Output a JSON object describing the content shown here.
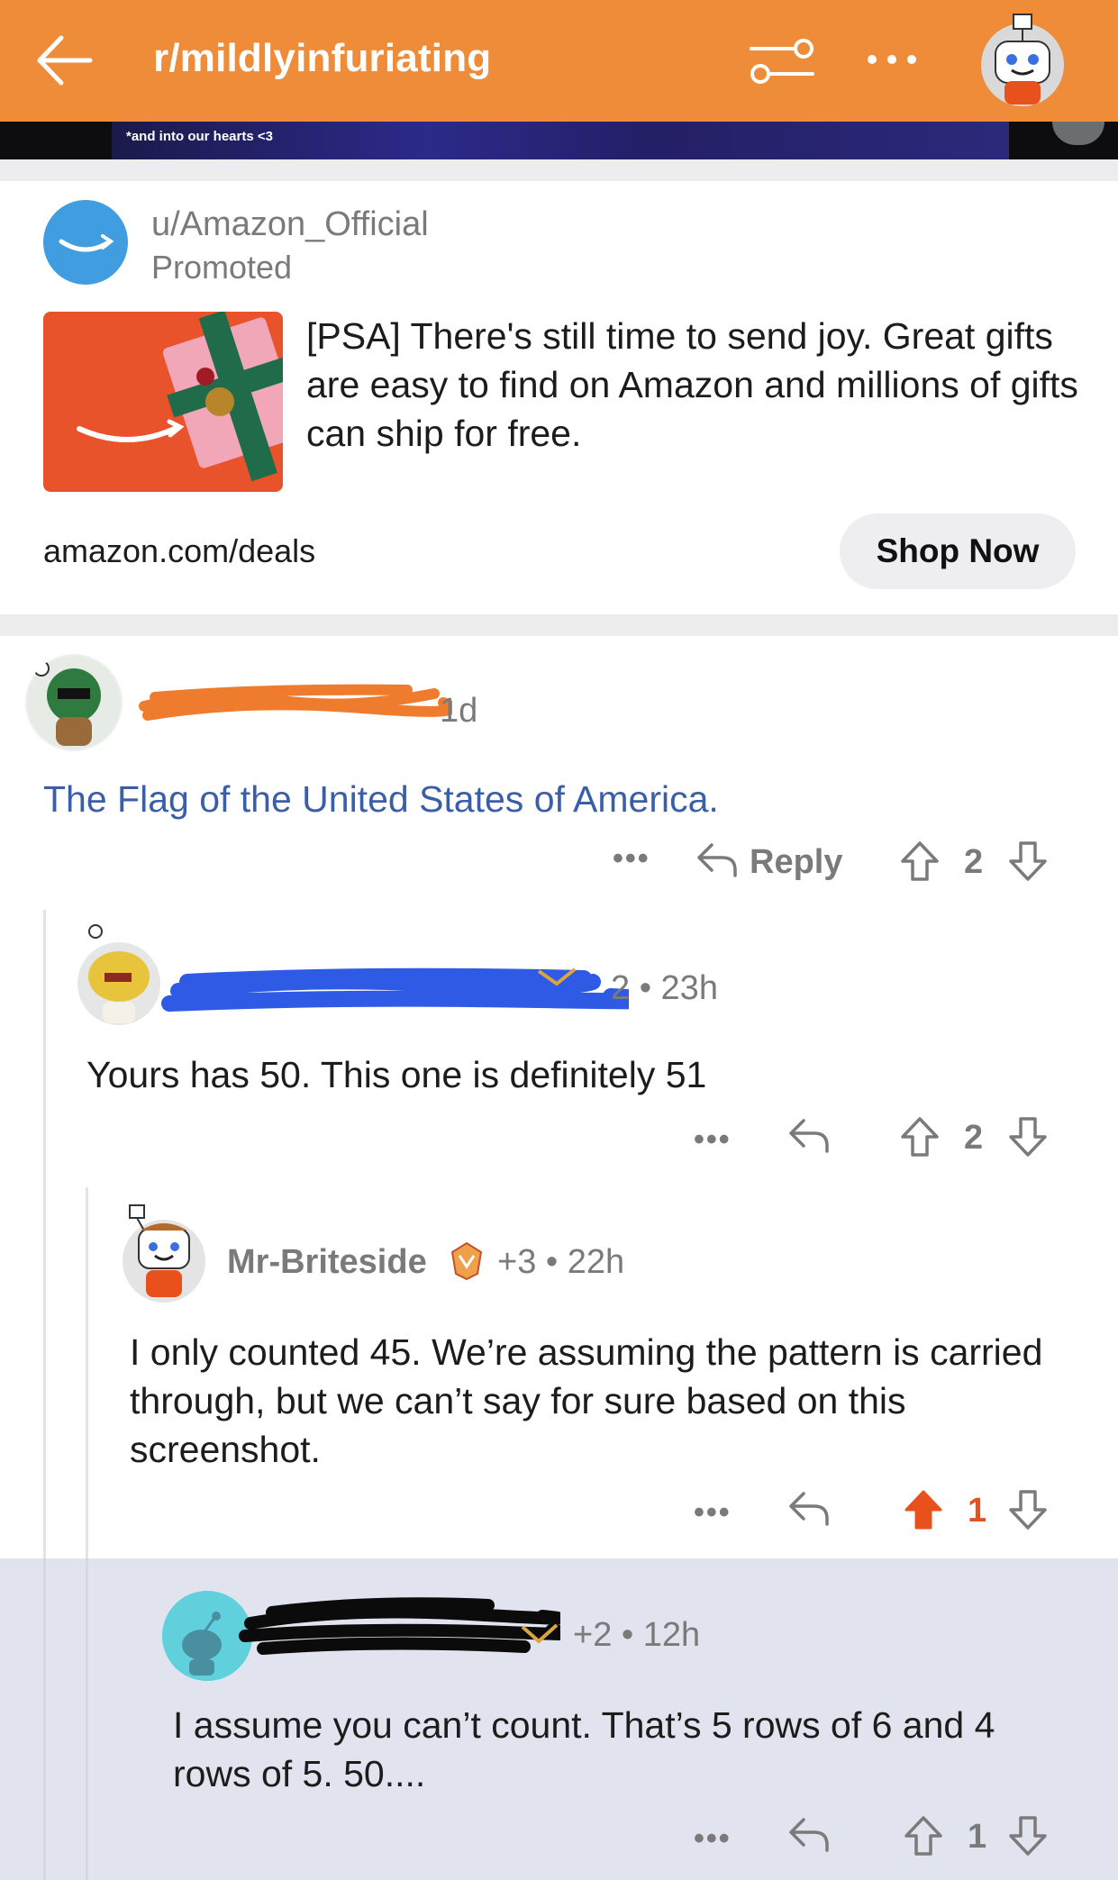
{
  "header": {
    "subreddit": "r/mildlyinfuriating"
  },
  "banner": {
    "text": "*and into our hearts <3"
  },
  "ad": {
    "user": "u/Amazon_Official",
    "promoted_label": "Promoted",
    "text": "[PSA] There's still time to send joy. Great gifts are easy to find on Amazon and millions of gifts can ship for free.",
    "url": "amazon.com/deals",
    "cta": "Shop Now"
  },
  "comments": [
    {
      "age": "1d",
      "text": "The Flag of the United States of America.",
      "more": "•••",
      "reply_label": "Reply",
      "votes": "2"
    },
    {
      "karma_age": "2 • 23h",
      "text": "Yours has 50. This one is definitely 51",
      "more": "•••",
      "votes": "2"
    },
    {
      "user": "Mr-Briteside",
      "karma_age": "+3 • 22h",
      "text": "I only counted 45. We’re assuming the pattern is carried through, but we can’t say for sure based on this screenshot.",
      "more": "•••",
      "votes": "1",
      "upvoted": true
    },
    {
      "karma_age": "+2 • 12h",
      "text": "I assume you can’t count. That’s 5 rows of 6 and 4 rows of 5. 50....",
      "more": "•••",
      "votes": "1"
    }
  ],
  "colors": {
    "header": "#ef8c3a",
    "link": "#3a5ea8",
    "upvote": "#e8501c",
    "highlight": "#e1e4ee"
  },
  "icons": [
    "back-arrow-icon",
    "filter-icon",
    "more-icon",
    "reply-icon",
    "upvote-icon",
    "downvote-icon"
  ]
}
